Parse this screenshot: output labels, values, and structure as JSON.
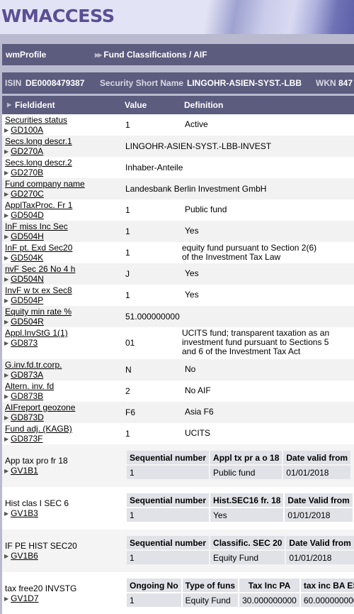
{
  "banner": {
    "logo": "WMACCESS"
  },
  "navbar": {
    "app": "wmProfile",
    "breadcrumb": "Fund Classifications / AIF"
  },
  "security": {
    "isin_label": "ISIN",
    "isin": "DE0008479387",
    "short_name_label": "Security Short Name",
    "short_name": "LINGOHR-ASIEN-SYST.-LBB",
    "wkn_label": "WKN",
    "wkn": "847"
  },
  "table_header": {
    "fieldident": "Fieldident",
    "value": "Value",
    "definition": "Definition"
  },
  "rows": [
    {
      "name": "Securities status",
      "code": "GD100A",
      "value": "1",
      "definition": "Active"
    },
    {
      "name": "Secs.long descr.1",
      "code": "GD270A",
      "value": "LINGOHR-ASIEN-SYST.-LBB-INVEST",
      "definition": ""
    },
    {
      "name": "Secs.long descr.2",
      "code": "GD270B",
      "value": "Inhaber-Anteile",
      "definition": ""
    },
    {
      "name": "Fund company name",
      "code": "GD270C",
      "value": "Landesbank Berlin Investment GmbH",
      "definition": ""
    },
    {
      "name": "ApplTaxProc. Fr 1",
      "code": "GD504D",
      "value": "1",
      "definition": "Public fund"
    },
    {
      "name": "InF miss Inc Sec",
      "code": "GD504H",
      "value": "1",
      "definition": "Yes"
    },
    {
      "name": "InF pt. Exd Sec20",
      "code": "GD504K",
      "value": "1",
      "definition": " equity fund pursuant to Section 2(6)\nof the Investment Tax Law"
    },
    {
      "name": "nvF Sec 26 No 4 h",
      "code": "GD504N",
      "value": "J",
      "definition": "Yes"
    },
    {
      "name": "InvF w tx ex Sec8",
      "code": "GD504P",
      "value": "1",
      "definition": "Yes"
    },
    {
      "name": "Equity min rate %",
      "code": "GD504R",
      "value": "51.000000000",
      "definition": ""
    },
    {
      "name": "Appl.InvStG 1(1)",
      "code": "GD873",
      "value": "01",
      "definition": " UCITS fund; transparent taxation as an\ninvestment fund pursuant to Sections 5\nand 6 of the Investment Tax Act"
    },
    {
      "name": "G.inv.fd.tr.corp.",
      "code": "GD873A",
      "value": "N",
      "definition": "No"
    },
    {
      "name": "Altern. inv. fd",
      "code": "GD873B",
      "value": "2",
      "definition": "No AIF"
    },
    {
      "name": "AIFreport geozone",
      "code": "GD873D",
      "value": "F6",
      "definition": "Asia F6"
    },
    {
      "name": "Fund adj. (KAGB)",
      "code": "GD873F",
      "value": "1",
      "definition": "UCITS"
    }
  ],
  "subtables": [
    {
      "name": "App tax pro fr 18",
      "code": "GV1B1",
      "headers": [
        "Sequential number",
        "Appl tx pr a o 18",
        "Date valid from"
      ],
      "rows": [
        [
          "1",
          "Public fund",
          "01/01/2018"
        ]
      ]
    },
    {
      "name": "Hist clas I SEC 6",
      "code": "GV1B3",
      "headers": [
        "Sequential number",
        "Hist.SEC16 fr. 18",
        "Date Valid from"
      ],
      "rows": [
        [
          "1",
          "Yes",
          "01/01/2018"
        ]
      ]
    },
    {
      "name": "IF PE HIST SEC20",
      "code": "GV1B6",
      "headers": [
        "Sequential number",
        "Classific. SEC 20",
        "Date Valid from"
      ],
      "rows": [
        [
          "1",
          "Equity Fund",
          "01/01/2018"
        ]
      ]
    },
    {
      "name": "tax free20 INVSTG",
      "code": "GV1D7",
      "headers": [
        "Ongoing No",
        "Type of funs",
        "Tax Inc PA",
        "tax inc BA ES"
      ],
      "rows": [
        [
          "1",
          "Equity Fund",
          "30.000000000",
          "60.000000000"
        ]
      ]
    }
  ]
}
